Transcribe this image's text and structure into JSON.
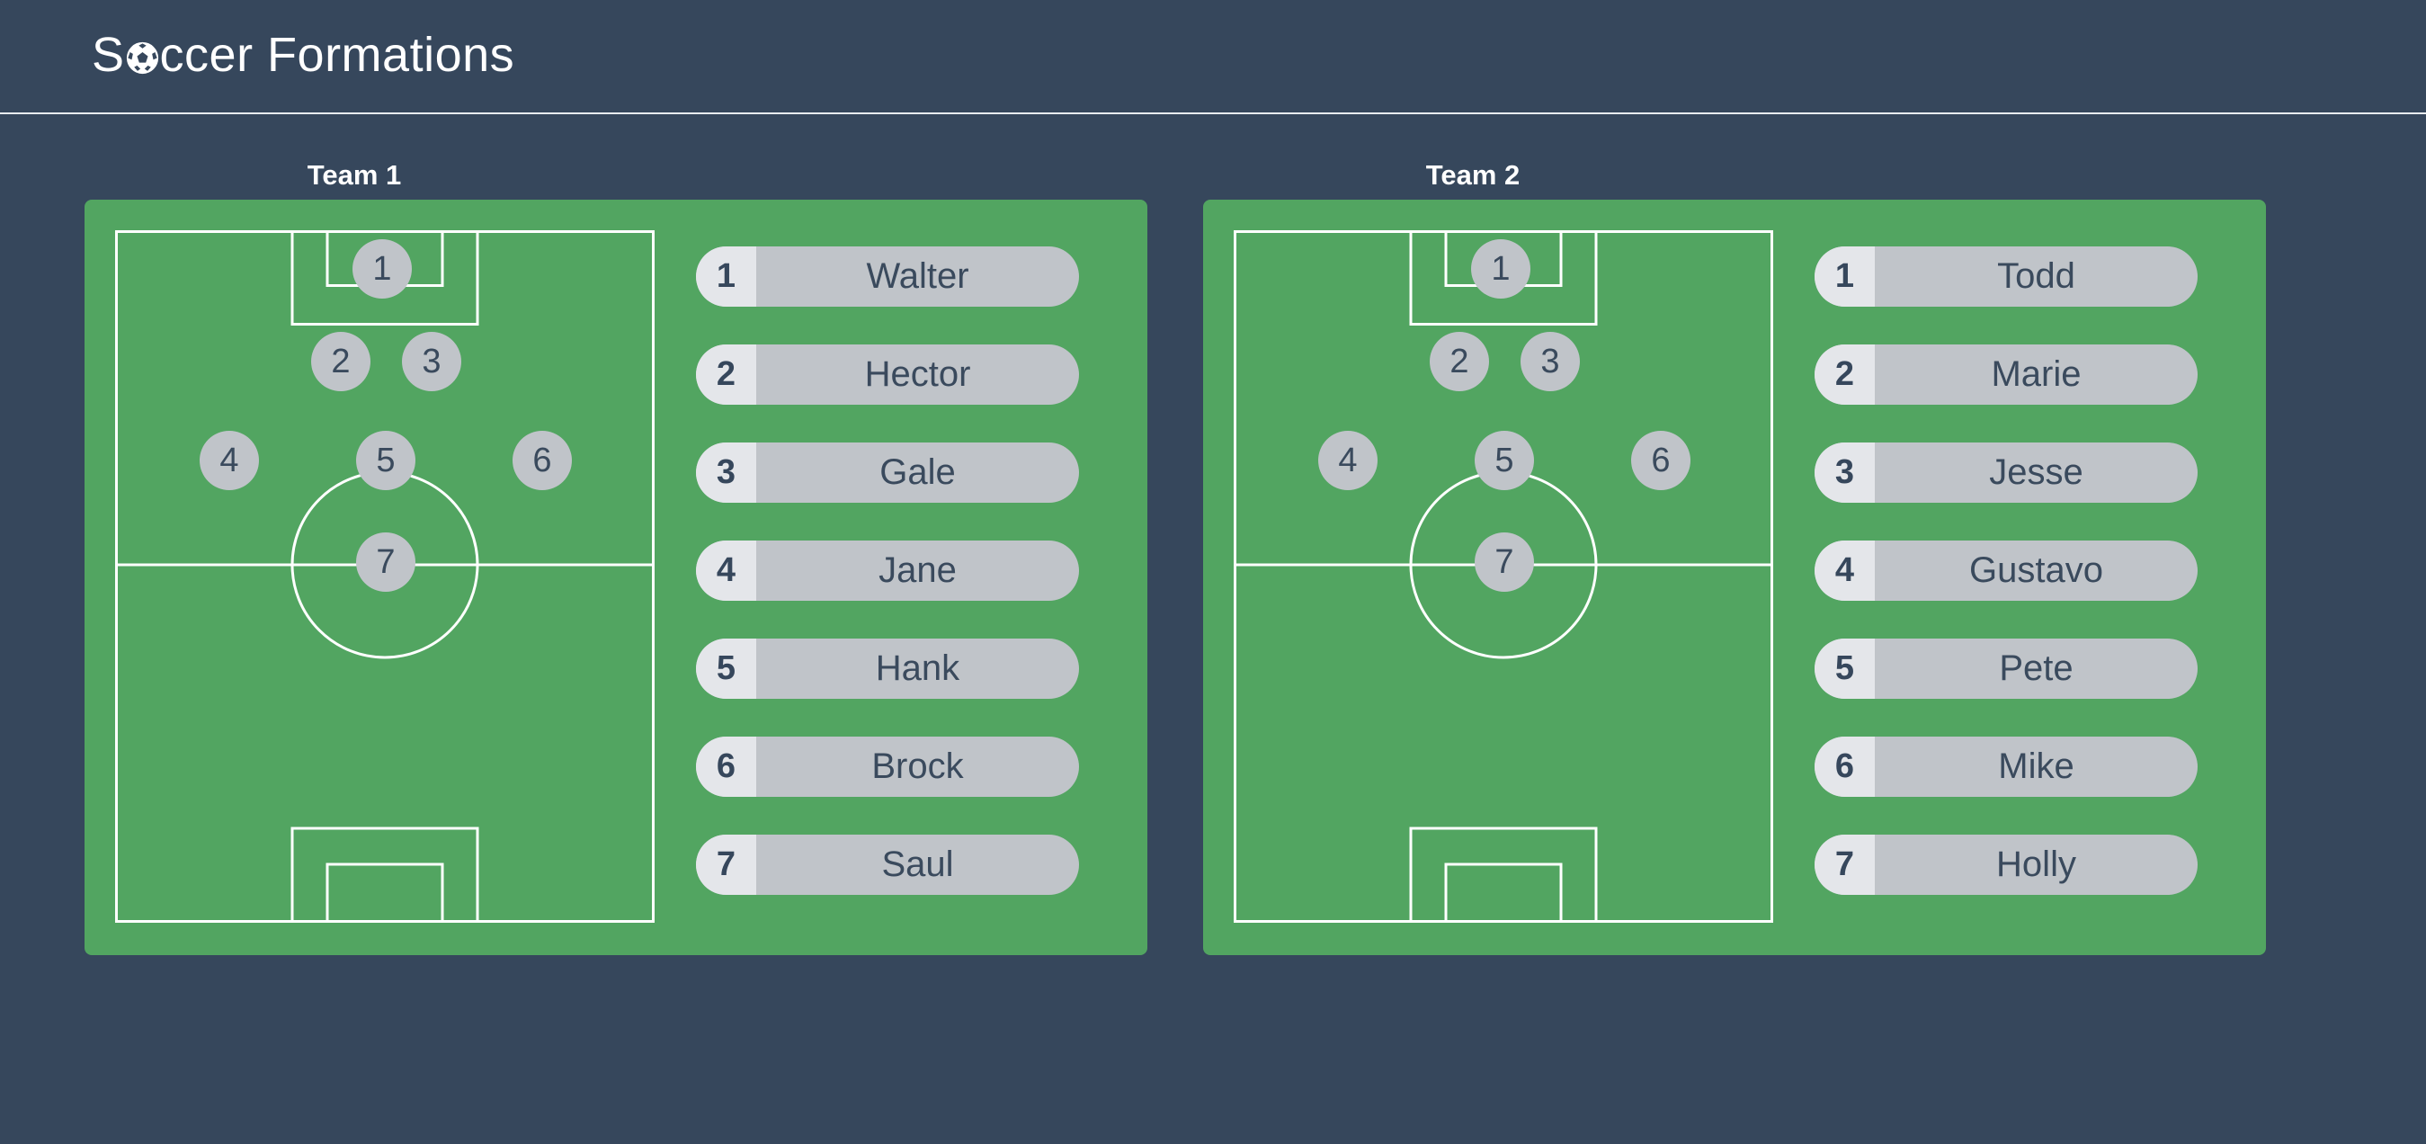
{
  "app": {
    "title_pre": "S",
    "title_post": "ccer Formations",
    "title_icon": "soccer-ball-icon"
  },
  "colors": {
    "background": "#36475c",
    "field": "#52a561",
    "marker": "#c0c4c9",
    "pill": "#c0c4c9",
    "pill_number_bg": "#e4e6ea",
    "text_dark": "#3a4a5d",
    "line": "#ffffff"
  },
  "teams": [
    {
      "title": "Team 1",
      "markers": [
        "1",
        "2",
        "3",
        "4",
        "5",
        "6",
        "7"
      ],
      "roster": [
        {
          "number": "1",
          "name": "Walter"
        },
        {
          "number": "2",
          "name": "Hector"
        },
        {
          "number": "3",
          "name": "Gale"
        },
        {
          "number": "4",
          "name": "Jane"
        },
        {
          "number": "5",
          "name": "Hank"
        },
        {
          "number": "6",
          "name": "Brock"
        },
        {
          "number": "7",
          "name": "Saul"
        }
      ]
    },
    {
      "title": "Team 2",
      "markers": [
        "1",
        "2",
        "3",
        "4",
        "5",
        "6",
        "7"
      ],
      "roster": [
        {
          "number": "1",
          "name": "Todd"
        },
        {
          "number": "2",
          "name": "Marie"
        },
        {
          "number": "3",
          "name": "Jesse"
        },
        {
          "number": "4",
          "name": "Gustavo"
        },
        {
          "number": "5",
          "name": "Pete"
        },
        {
          "number": "6",
          "name": "Mike"
        },
        {
          "number": "7",
          "name": "Holly"
        }
      ]
    }
  ]
}
